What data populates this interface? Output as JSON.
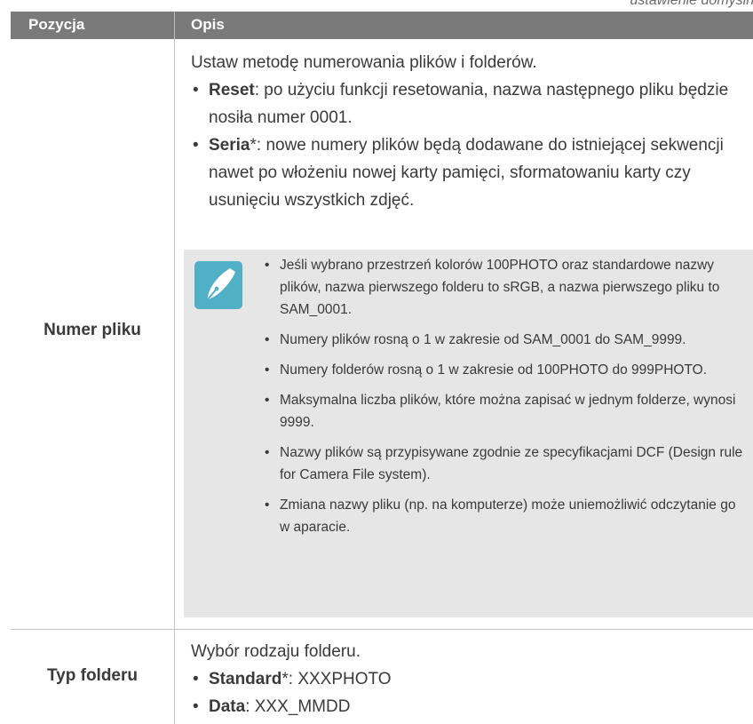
{
  "corner_note": "ustawienie domyślne",
  "header": {
    "col1": "Pozycja",
    "col2": "Opis"
  },
  "rows": [
    {
      "label": "Numer pliku",
      "intro": "Ustaw metodę numerowania plików i folderów.",
      "bullets": [
        {
          "term": "Reset",
          "asterisk": "",
          "text": ": po użyciu funkcji resetowania, nazwa następnego pliku będzie nosiła numer 0001."
        },
        {
          "term": "Seria",
          "asterisk": "*",
          "text": ": nowe numery plików będą dodawane do istniejącej sekwencji nawet po włożeniu nowej karty pamięci, sformatowaniu karty czy usunięciu wszystkich zdjęć."
        }
      ],
      "notes": [
        "Jeśli wybrano przestrzeń kolorów 100PHOTO oraz standardowe nazwy plików, nazwa pierwszego folderu to sRGB, a nazwa pierwszego pliku to SAM_0001.",
        "Numery plików rosną o 1 w zakresie od SAM_0001 do SAM_9999.",
        "Numery folderów rosną o 1 w zakresie od 100PHOTO do 999PHOTO.",
        "Maksymalna liczba plików, które można zapisać w jednym folderze, wynosi 9999.",
        "Nazwy plików są przypisywane zgodnie ze specyfikacjami DCF (Design rule for Camera File system).",
        "Zmiana nazwy pliku (np. na komputerze) może uniemożliwić odczytanie go w aparacie."
      ]
    },
    {
      "label": "Typ folderu",
      "intro": "Wybór rodzaju folderu.",
      "bullets": [
        {
          "term": "Standard",
          "asterisk": "*",
          "text": ": XXXPHOTO"
        },
        {
          "term": "Data",
          "asterisk": "",
          "text": ": XXX_MMDD"
        }
      ]
    }
  ],
  "colors": {
    "header_bg": "#7a7a7a",
    "note_bg": "#e6e6e6",
    "icon_bg": "#4fb0c6"
  },
  "icons": {
    "note": "pen-nib-icon"
  }
}
